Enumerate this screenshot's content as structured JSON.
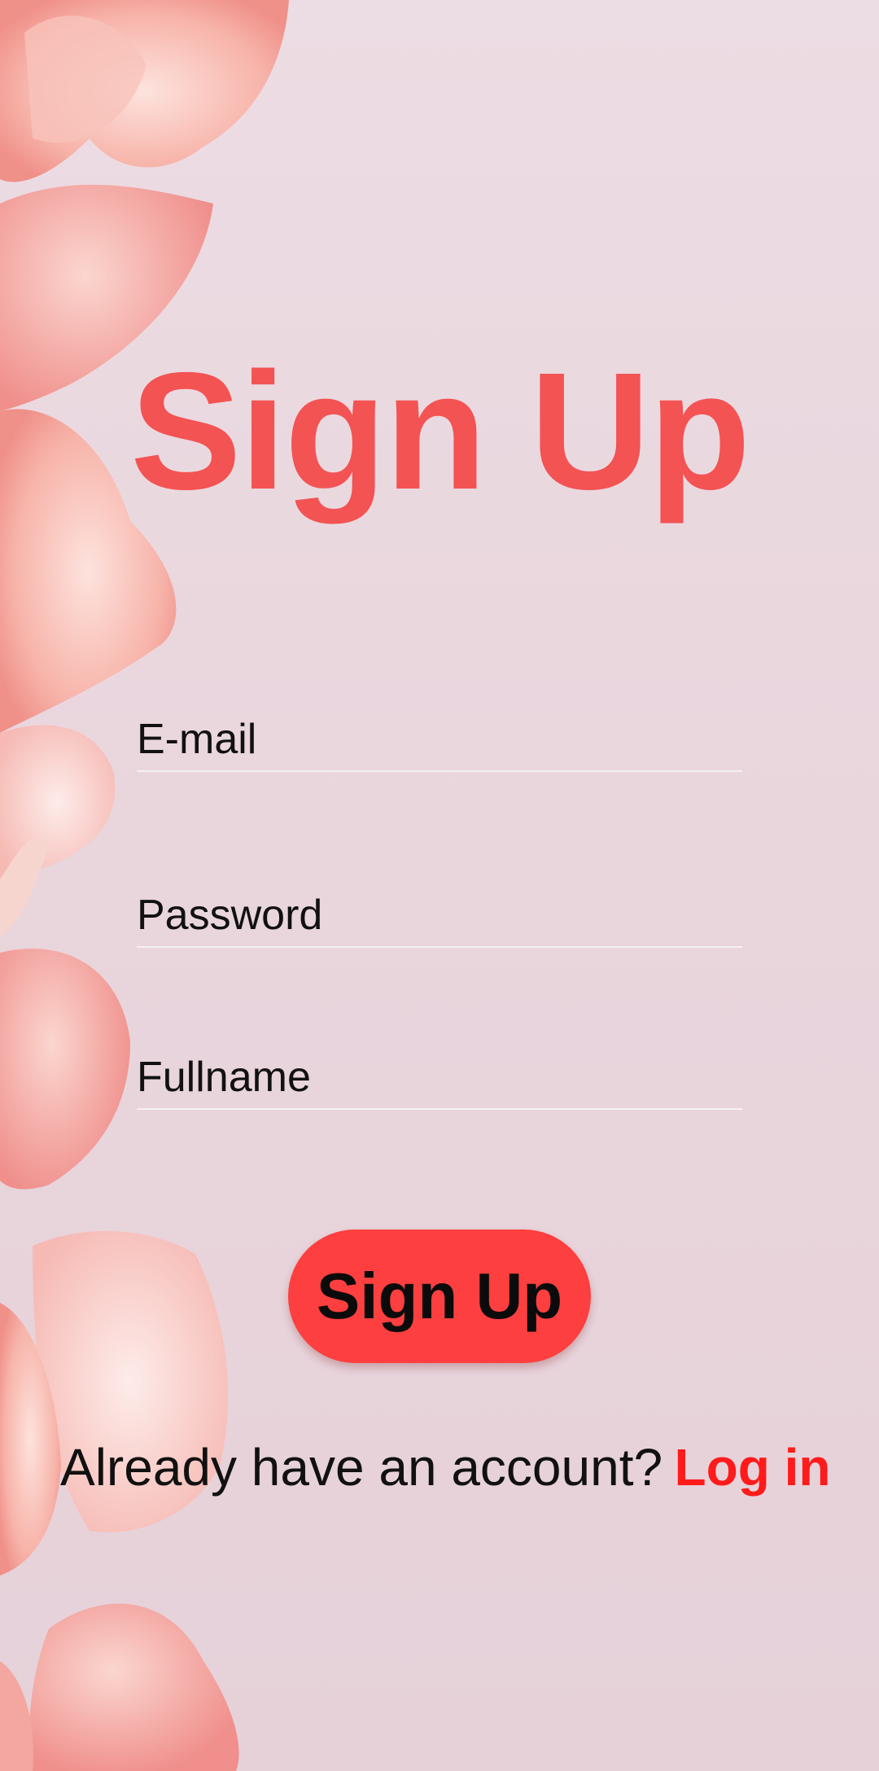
{
  "screen": {
    "title": "Sign Up",
    "accent_color": "#f35353",
    "button_color": "#fd3f3f",
    "link_color": "#ff1b1b",
    "background_color": "#ead8df"
  },
  "form": {
    "email_placeholder": "E-mail",
    "password_placeholder": "Password",
    "fullname_placeholder": "Fullname",
    "submit_label": "Sign Up"
  },
  "footer": {
    "prompt": "Already have an account?",
    "login_label": "Log in"
  },
  "decor": {
    "background_image": "rose-petals"
  }
}
